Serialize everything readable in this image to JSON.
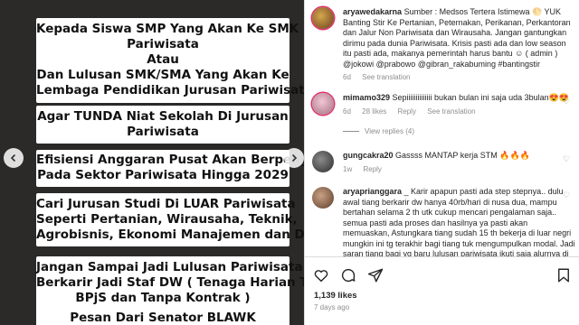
{
  "post_image": {
    "banners": [
      {
        "lines": [
          "Kepada Siswa SMP Yang Akan Ke SMK",
          "Pariwisata",
          "Atau",
          "Dan Lulusan SMK/SMA Yang Akan Ke",
          "Lembaga Pendidikan Jurusan Pariwisata"
        ]
      },
      {
        "lines": [
          "Agar TUNDA Niat Sekolah Di Jurusan",
          "Pariwisata"
        ]
      },
      {
        "lines": [
          "Efisiensi Anggaran Pusat Akan Berpengaruh",
          "Pada Sektor Pariwisata Hingga 2029"
        ]
      },
      {
        "lines": [
          "Cari Jurusan Studi Di LUAR Pariwisata",
          "Seperti Pertanian, Wirausaha, Teknik,",
          "Agrobisnis, Ekonomi Manajemen dan Digital"
        ]
      },
      {
        "lines": [
          "Jangan Sampai Jadi Lulusan Pariwisata Yang",
          "Berkarir Jadi Staf DW ( Tenaga Harian Tanpa",
          "BPjS dan Tanpa Kontrak )"
        ]
      },
      {
        "lines": [
          "Pesan Dari Senator BLAWK"
        ]
      }
    ]
  },
  "caption": {
    "username": "aryawedakarna",
    "text": "Sumber : Medsos Tertera Istimewa 🌕 YUK Banting Stir Ke Pertanian, Peternakan, Perikanan, Perkantoran dan Jalur Non Pariwisata dan Wirausaha. Jangan gantungkan dirimu pada dunia Pariwisata. Krisis pasti ada dan low season itu pasti ada, makanya pemerintah harus bantu ☺ ( admin ) @jokowi @prabowo @gibran_rakabuming #bantingstir",
    "time": "6d",
    "see_translation": "See translation"
  },
  "comments": [
    {
      "username": "mimamo329",
      "text": "Sepiiiiiiiiiiiiii bukan bulan ini saja uda 3bulan😍😍",
      "time": "6d",
      "likes": "28 likes",
      "reply": "Reply",
      "see_translation": "See translation",
      "view_replies": "View replies (4)"
    },
    {
      "username": "gungcakra20",
      "text": "Gassss MANTAP kerja STM 🔥🔥🔥",
      "time": "1w",
      "likes": "",
      "reply": "Reply",
      "see_translation": ""
    },
    {
      "username": "aryaprianggara",
      "text": "_ Karir apapun pasti ada step stepnya.. dulu awal tiang berkarir dw hanya 40rb/hari di nusa dua, mampu bertahan selama 2 th utk cukup mencari pengalaman saja.. semua pasti ada proses dan hasilnya ya pasti akan memuaskan, Astungkara tiang sudah 15 th bekerja di luar negri mungkin ini tg terakhir bagi tiang tuk mengumpulkan modal. Jadi saran tiang bagi yg baru lulusan pariwisata ikuti saja alurnya di bali",
      "time": "",
      "likes": "",
      "reply": "",
      "see_translation": ""
    }
  ],
  "actions": {
    "likes_count": "1,139 likes",
    "post_age": "7 days ago"
  },
  "colors": {
    "image_background": "#2c2a28",
    "banner_background": "#ffffff",
    "meta_text": "#8e8e8e",
    "border": "#dbdbdb"
  }
}
